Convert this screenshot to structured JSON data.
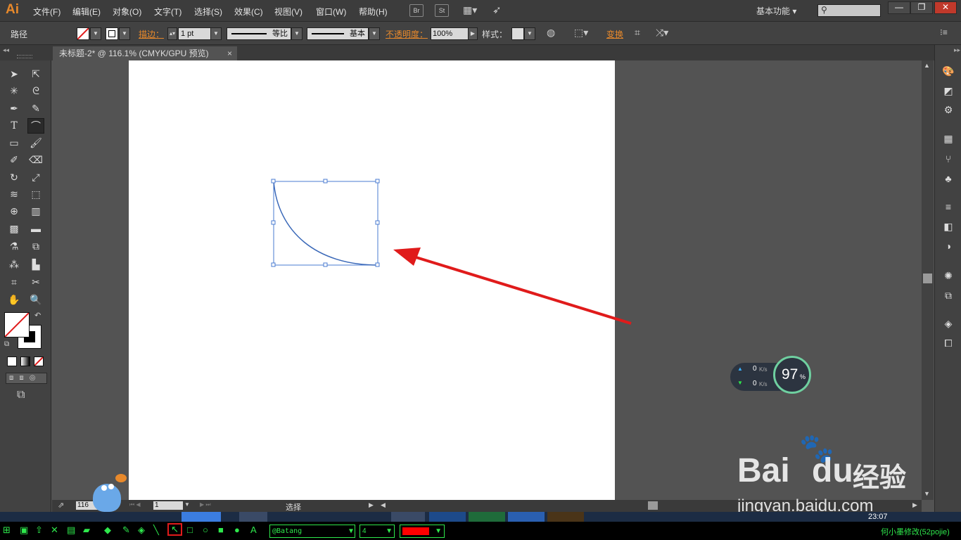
{
  "app": {
    "logo": "Ai"
  },
  "menu": [
    "文件(F)",
    "编辑(E)",
    "对象(O)",
    "文字(T)",
    "选择(S)",
    "效果(C)",
    "视图(V)",
    "窗口(W)",
    "帮助(H)"
  ],
  "menu_buttons": {
    "br": "Br",
    "st": "St"
  },
  "workspace": "基本功能",
  "window_controls": {
    "minimize": "—",
    "restore": "❐",
    "close": "✕"
  },
  "control": {
    "object_type": "路径",
    "stroke_label": "描边：",
    "stroke_value": "1 pt",
    "profile": "等比",
    "brush": "基本",
    "opacity_label": "不透明度：",
    "opacity_value": "100%",
    "style_label": "样式：",
    "transform_label": "变换"
  },
  "document": {
    "tab_title": "未标题-2* @ 116.1% (CMYK/GPU 预览)",
    "close": "×"
  },
  "status": {
    "zoom": "116",
    "page": "1",
    "tool_name": "选择"
  },
  "net_widget": {
    "up": "0",
    "down": "0",
    "unit": "K/s",
    "percent": "97",
    "pct_sign": "%"
  },
  "watermark": {
    "brand": "Bai",
    "brand2": "du",
    "cn": "经验",
    "url": "jingyan.baidu.com"
  },
  "taskbar": {
    "time": "23:07"
  },
  "bottombar": {
    "font": "@Batang",
    "size": "4",
    "credit": "何小墨修改(52pojie)"
  },
  "colors": {
    "accent": "#e8892b",
    "selection": "#4a7bd0",
    "arrow": "#e01b1b",
    "green": "#2ee84c"
  }
}
